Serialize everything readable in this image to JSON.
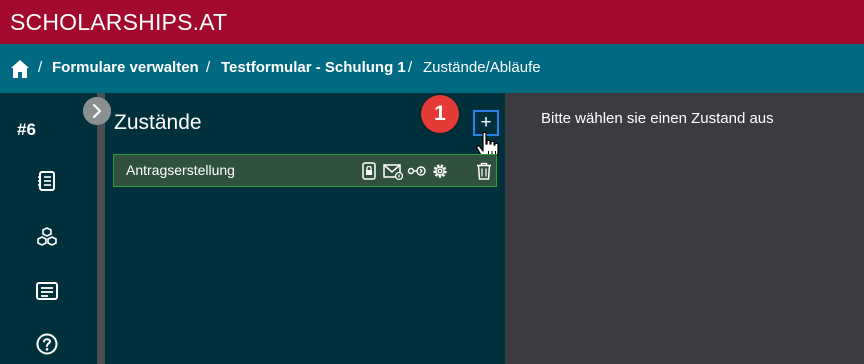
{
  "app": {
    "brand": "SCHOLARSHIPS.AT"
  },
  "breadcrumb": {
    "items": [
      "Formulare verwalten",
      "Testformular - Schulung 1",
      "Zustände/Abläufe"
    ],
    "separator": "/"
  },
  "sidebar": {
    "id_label": "#6",
    "icons": [
      "form-list-icon",
      "cubes-icon",
      "message-icon",
      "help-icon"
    ]
  },
  "states_panel": {
    "title": "Zustände",
    "step_badge": "1",
    "add_label": "+",
    "rows": [
      {
        "label": "Antragserstellung",
        "icons": [
          "lock-icon",
          "mail-icon",
          "transition-icon",
          "gear-icon",
          "trash-icon"
        ]
      }
    ]
  },
  "detail_panel": {
    "hint": "Bitte wählen sie einen Zustand aus"
  },
  "colors": {
    "topbar": "#a3092c",
    "breadcrumb_bar": "#006a83",
    "sidebar": "#00303b",
    "row_border": "#2f9c3a",
    "badge": "#e53a35",
    "highlight": "#2a80e8"
  }
}
